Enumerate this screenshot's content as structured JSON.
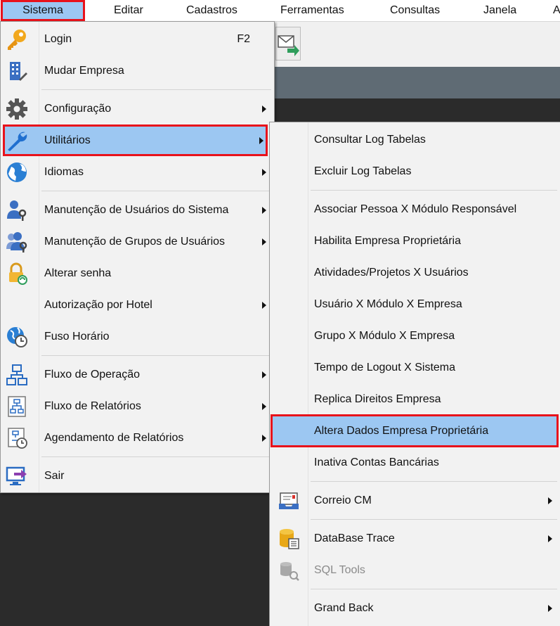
{
  "menubar": {
    "items": [
      {
        "label": "Sistema",
        "active": true
      },
      {
        "label": "Editar"
      },
      {
        "label": "Cadastros"
      },
      {
        "label": "Ferramentas"
      },
      {
        "label": "Consultas"
      },
      {
        "label": "Janela"
      },
      {
        "label": "A"
      }
    ]
  },
  "sistema_menu": {
    "items": [
      {
        "label": "Login",
        "shortcut": "F2",
        "icon": "key-icon"
      },
      {
        "label": "Mudar Empresa",
        "icon": "building-icon"
      },
      {
        "label": "Configuração",
        "icon": "gear-icon",
        "submenu": true
      },
      {
        "label": "Utilitários",
        "icon": "wrench-icon",
        "submenu": true,
        "highlighted": true
      },
      {
        "label": "Idiomas",
        "icon": "globe-icon",
        "submenu": true
      },
      {
        "label": "Manutenção de Usuários do Sistema",
        "icon": "user-key-icon",
        "submenu": true
      },
      {
        "label": "Manutenção de Grupos de Usuários",
        "icon": "users-key-icon",
        "submenu": true
      },
      {
        "label": "Alterar senha",
        "icon": "lock-refresh-icon"
      },
      {
        "label": "Autorização por Hotel",
        "submenu": true
      },
      {
        "label": "Fuso Horário",
        "icon": "globe-clock-icon"
      },
      {
        "label": "Fluxo de Operação",
        "icon": "flowchart-icon",
        "submenu": true
      },
      {
        "label": "Fluxo de Relatórios",
        "icon": "report-flow-icon",
        "submenu": true
      },
      {
        "label": "Agendamento de Relatórios",
        "icon": "report-schedule-icon",
        "submenu": true
      },
      {
        "label": "Sair",
        "icon": "exit-monitor-icon"
      }
    ]
  },
  "utilitarios_menu": {
    "items": [
      {
        "label": "Consultar Log Tabelas"
      },
      {
        "label": "Excluir Log Tabelas"
      },
      {
        "label": "Associar Pessoa X Módulo Responsável"
      },
      {
        "label": "Habilita Empresa Proprietária"
      },
      {
        "label": "Atividades/Projetos X Usuários"
      },
      {
        "label": "Usuário X Módulo X Empresa"
      },
      {
        "label": "Grupo X Módulo X Empresa"
      },
      {
        "label": "Tempo de Logout X Sistema"
      },
      {
        "label": "Replica Direitos Empresa"
      },
      {
        "label": "Altera Dados Empresa Proprietária",
        "highlighted": true
      },
      {
        "label": "Inativa Contas Bancárias"
      },
      {
        "label": "Correio CM",
        "icon": "mail-tray-icon",
        "submenu": true
      },
      {
        "label": "DataBase Trace",
        "icon": "database-trace-icon",
        "submenu": true
      },
      {
        "label": "SQL Tools",
        "icon": "sql-tools-icon",
        "disabled": true
      },
      {
        "label": "Grand Back",
        "submenu": true
      }
    ]
  },
  "colors": {
    "highlight": "#9cc7f2",
    "callout": "#e8121b",
    "menu_bg": "#f2f2f2"
  }
}
